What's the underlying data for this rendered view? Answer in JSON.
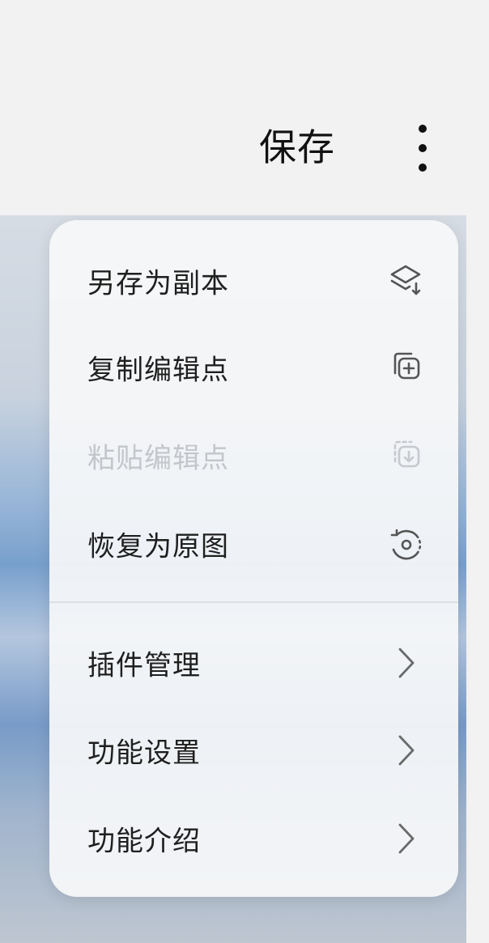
{
  "toolbar": {
    "save_label": "保存"
  },
  "menu": {
    "items": [
      {
        "label": "另存为副本",
        "icon": "save-copy-icon",
        "enabled": true
      },
      {
        "label": "复制编辑点",
        "icon": "copy-edits-icon",
        "enabled": true
      },
      {
        "label": "粘贴编辑点",
        "icon": "paste-edits-icon",
        "enabled": false
      },
      {
        "label": "恢复为原图",
        "icon": "revert-icon",
        "enabled": true
      },
      {
        "label": "插件管理",
        "icon": "chevron-right-icon",
        "enabled": true
      },
      {
        "label": "功能设置",
        "icon": "chevron-right-icon",
        "enabled": true
      },
      {
        "label": "功能介绍",
        "icon": "chevron-right-icon",
        "enabled": true
      }
    ]
  }
}
